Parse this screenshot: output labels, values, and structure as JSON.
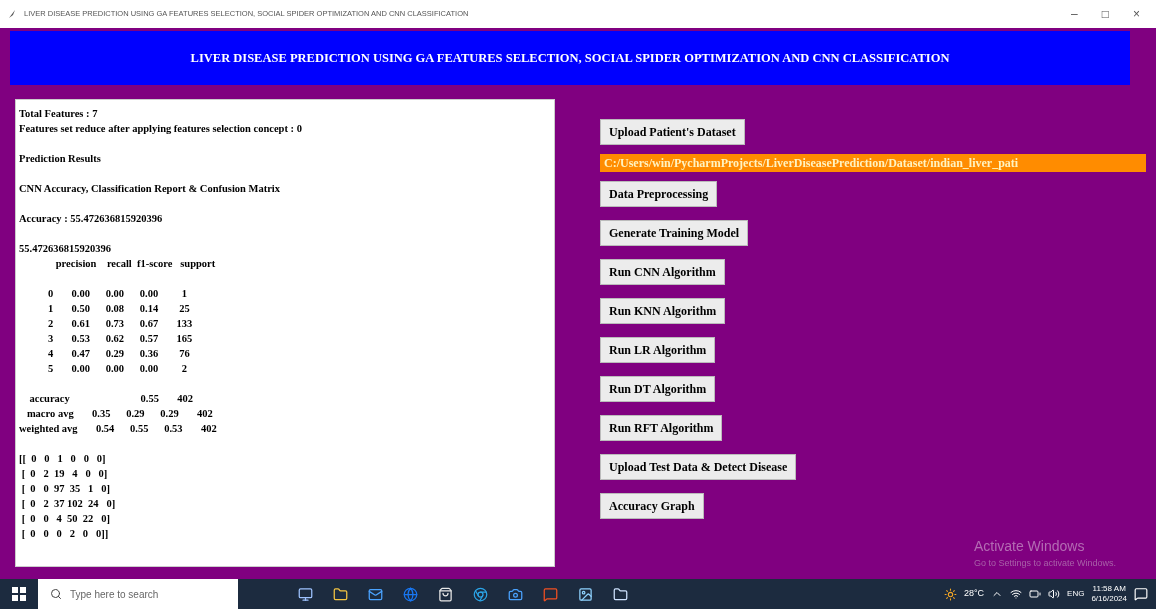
{
  "window": {
    "title": "LIVER DISEASE PREDICTION USING GA FEATURES SELECTION, SOCIAL SPIDER OPTIMIZATION AND CNN CLASSIFICATION",
    "controls": [
      "–",
      "□",
      "×"
    ]
  },
  "header": "LIVER DISEASE PREDICTION USING GA FEATURES SELECTION, SOCIAL SPIDER OPTIMIZATION AND CNN CLASSIFICATION",
  "output_blocks": [
    [
      "Total Features : 7",
      "Features set reduce after applying features selection concept : 0"
    ],
    [
      "Prediction Results"
    ],
    [
      "CNN Accuracy, Classification Report & Confusion Matrix"
    ],
    [
      "Accuracy : 55.472636815920396"
    ],
    [
      "55.472636815920396",
      "              precision    recall  f1-score   support"
    ],
    [
      "           0       0.00      0.00      0.00         1",
      "           1       0.50      0.08      0.14        25",
      "           2       0.61      0.73      0.67       133",
      "           3       0.53      0.62      0.57       165",
      "           4       0.47      0.29      0.36        76",
      "           5       0.00      0.00      0.00         2"
    ],
    [
      "    accuracy                           0.55       402",
      "   macro avg       0.35      0.29      0.29       402",
      "weighted avg       0.54      0.55      0.53       402"
    ],
    [
      "[[  0   0   1   0   0   0]",
      " [  0   2  19   4   0   0]",
      " [  0   0  97  35   1   0]",
      " [  0   2  37 102  24   0]",
      " [  0   0   4  50  22   0]",
      " [  0   0   0   2   0   0]]"
    ]
  ],
  "buttons": [
    {
      "kind": "button",
      "label": "Upload Patient's Dataset"
    },
    {
      "kind": "path",
      "label": "C:/Users/win/PycharmProjects/LiverDiseasePrediction/Dataset/indian_liver_pati"
    },
    {
      "kind": "button",
      "label": "Data Preprocessing"
    },
    {
      "kind": "button",
      "label": "Generate Training Model"
    },
    {
      "kind": "button",
      "label": "Run CNN Algorithm"
    },
    {
      "kind": "button",
      "label": "Run KNN Algorithm"
    },
    {
      "kind": "button",
      "label": "Run LR Algorithm"
    },
    {
      "kind": "button",
      "label": "Run DT Algorithm"
    },
    {
      "kind": "button",
      "label": "Run RFT Algorithm"
    },
    {
      "kind": "button",
      "label": "Upload Test Data & Detect Disease"
    },
    {
      "kind": "button",
      "label": "Accuracy Graph"
    }
  ],
  "activation_notice": {
    "title": "Activate Windows",
    "subtitle": "Go to Settings to activate Windows."
  },
  "taskbar": {
    "search_placeholder": "Type here to search",
    "weather": "28°C",
    "language": "ENG",
    "time": "11:58 AM",
    "date": "6/16/2024"
  }
}
